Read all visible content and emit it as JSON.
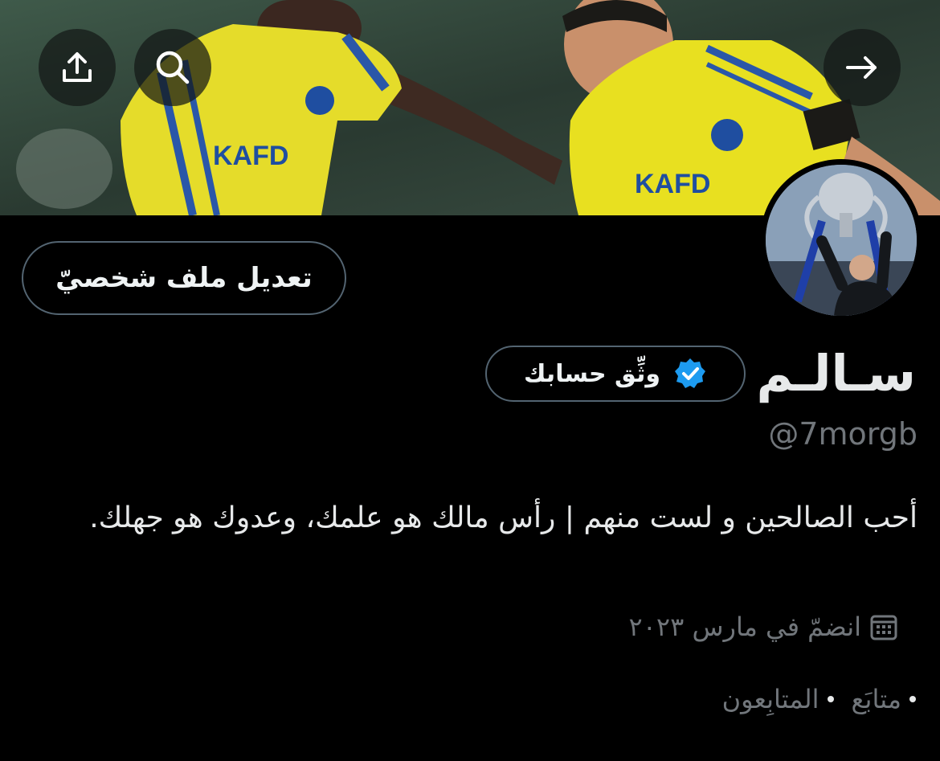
{
  "header": {
    "share_icon": "upload-icon",
    "search_icon": "search-icon",
    "forward_icon": "arrow-right-icon"
  },
  "profile": {
    "name": "سـالـم",
    "handle": "@7morgb",
    "bio": "أحب الصالحين و لست منهم | رأس مالك هو علمك، وعدوك هو جهلك.",
    "joined": "انضمّ في مارس ٢٠٢٣",
    "edit_profile_label": "تعديل ملف شخصيّ",
    "verify_label": "وثِّق حسابك",
    "following_label": "متابَع",
    "followers_label": "المتابِعون"
  },
  "colors": {
    "background": "#000000",
    "border": "#536471",
    "muted_text": "#71767b",
    "verified_badge": "#1d9bf0",
    "jersey_yellow": "#e8e020",
    "jersey_blue": "#1f4ea0"
  }
}
